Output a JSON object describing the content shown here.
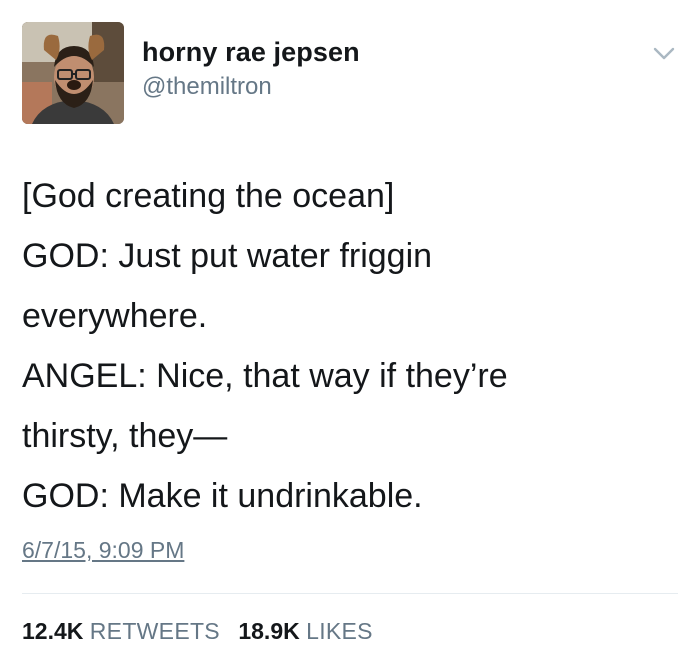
{
  "author": {
    "display_name": "horny rae jepsen",
    "handle": "@themiltron",
    "avatar_icon": "profile-photo-with-dog-ears-filter"
  },
  "menu": {
    "icon": "chevron-down-icon"
  },
  "tweet": {
    "lines": [
      "[God creating the ocean]",
      "GOD: Just put water friggin",
      "everywhere.",
      "ANGEL: Nice, that way if they’re",
      "thirsty, they—",
      "GOD: Make it undrinkable."
    ],
    "timestamp": "6/7/15, 9:09 PM"
  },
  "stats": {
    "retweets_count": "12.4K",
    "retweets_label": "RETWEETS",
    "likes_count": "18.9K",
    "likes_label": "LIKES"
  },
  "colors": {
    "text_primary": "#14171a",
    "text_secondary": "#657786",
    "divider": "#e6ecf0",
    "background": "#ffffff"
  }
}
